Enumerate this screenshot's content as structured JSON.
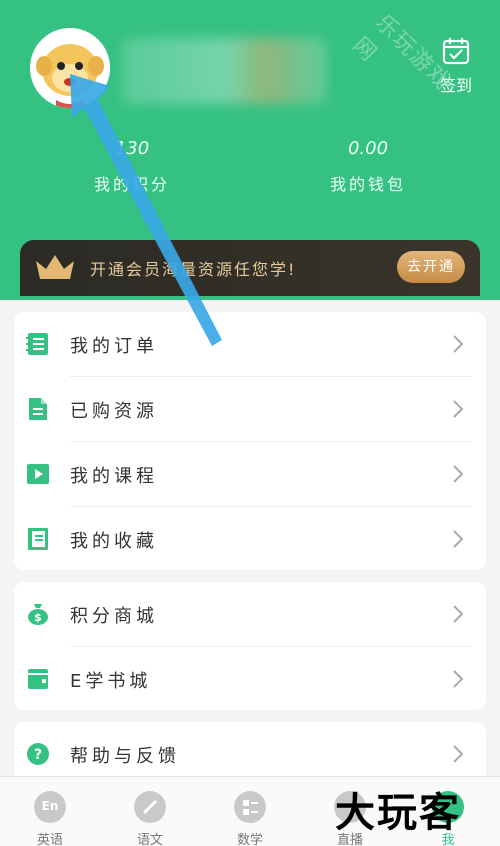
{
  "header": {
    "checkin_label": "签到",
    "points_value": "130",
    "points_label": "我的积分",
    "wallet_value": "0.00",
    "wallet_label": "我的钱包"
  },
  "vip": {
    "text": "开通会员海量资源任您学!",
    "button_label": "去开通"
  },
  "menu_group1": [
    {
      "label": "我的订单",
      "icon": "order-icon"
    },
    {
      "label": "已购资源",
      "icon": "purchased-doc-icon"
    },
    {
      "label": "我的课程",
      "icon": "play-course-icon"
    },
    {
      "label": "我的收藏",
      "icon": "bookmark-book-icon"
    }
  ],
  "menu_group2": [
    {
      "label": "积分商城",
      "icon": "money-bag-icon"
    },
    {
      "label": "E学书城",
      "icon": "book-store-icon"
    }
  ],
  "menu_group3": [
    {
      "label": "帮助与反馈",
      "icon": "help-icon"
    }
  ],
  "tabs": [
    {
      "label": "英语",
      "icon": "english-en-icon",
      "active": false
    },
    {
      "label": "语文",
      "icon": "pencil-icon",
      "active": false
    },
    {
      "label": "数学",
      "icon": "math-icon",
      "active": false
    },
    {
      "label": "直播",
      "icon": "live-icon",
      "active": false
    },
    {
      "label": "我",
      "icon": "profile-icon",
      "active": true
    }
  ],
  "watermarks": {
    "top_right": "乐玩游戏网",
    "bottom": "大玩客"
  },
  "colors": {
    "primary_green": "#35c182",
    "vip_gold": "#c58c46",
    "vip_dark": "#2b2a25",
    "annotation_arrow": "#3aa8e6"
  }
}
